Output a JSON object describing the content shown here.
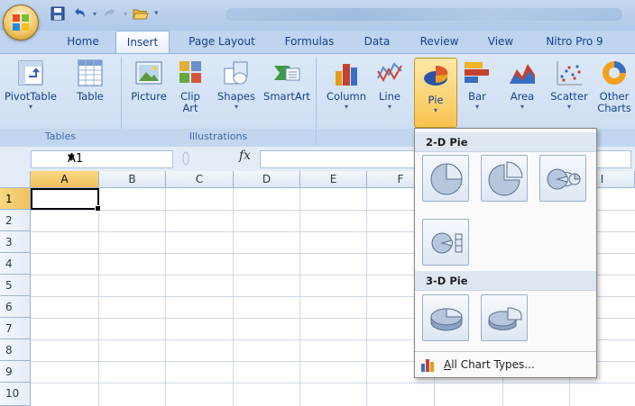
{
  "tabs": {
    "home": "Home",
    "insert": "Insert",
    "page_layout": "Page Layout",
    "formulas": "Formulas",
    "data": "Data",
    "review": "Review",
    "view": "View",
    "nitro": "Nitro Pro 9"
  },
  "ribbon": {
    "tables": {
      "label": "Tables",
      "pivottable": "PivotTable",
      "table": "Table"
    },
    "illustrations": {
      "label": "Illustrations",
      "picture": "Picture",
      "clipart_1": "Clip",
      "clipart_2": "Art",
      "shapes": "Shapes",
      "smartart": "SmartArt"
    },
    "charts": {
      "column": "Column",
      "line": "Line",
      "pie": "Pie",
      "bar": "Bar",
      "area": "Area",
      "scatter": "Scatter",
      "other_1": "Other",
      "other_2": "Charts"
    }
  },
  "formula_bar": {
    "name_box": "A1",
    "fx": "fx"
  },
  "grid": {
    "columns": [
      "A",
      "B",
      "C",
      "D",
      "E",
      "F",
      "I"
    ],
    "rows": [
      "1",
      "2",
      "3",
      "4",
      "5",
      "6",
      "7",
      "8",
      "9",
      "10"
    ]
  },
  "dropdown": {
    "section_2d": "2-D Pie",
    "section_3d": "3-D Pie",
    "all_chart_types_prefix": "A",
    "all_chart_types_rest": "ll Chart Types..."
  },
  "colors": {
    "accent": "#15428b",
    "selected_header": "#f1c15f",
    "ribbon_bg": "#d0e0f4"
  }
}
